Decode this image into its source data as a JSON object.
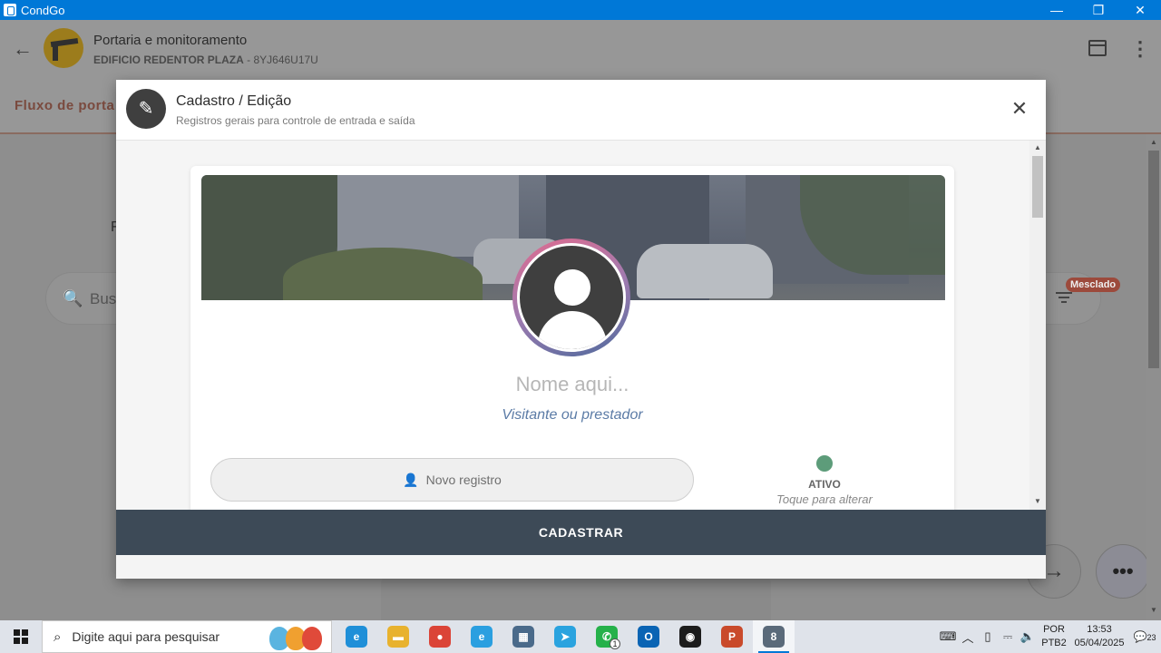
{
  "window": {
    "title": "CondGo",
    "minimize": "—",
    "restore": "❐",
    "close": "✕"
  },
  "app_header": {
    "back": "←",
    "title": "Portaria e monitoramento",
    "building": "EDIFICIO REDENTOR PLAZA",
    "code": " - 8YJ646U17U",
    "menu": "⋮"
  },
  "background": {
    "tab_label": "Fluxo de porta",
    "letter": "F",
    "search_icon": "🔍",
    "search_placeholder": "Bus",
    "badge": "Mesclado",
    "fab_next": "→",
    "fab_more": "•••"
  },
  "modal": {
    "edit_icon": "✎",
    "title": "Cadastro / Edição",
    "subtitle": "Registros gerais para controle de entrada e saída",
    "close": "✕",
    "name_placeholder": "Nome aqui...",
    "role": "Visitante ou prestador",
    "new_register_icon": "👤",
    "new_register_label": "Novo registro",
    "status_label": "ATIVO",
    "status_hint": "Toque para alterar",
    "status_color": "#5d9c7a",
    "submit_label": "CADASTRAR"
  },
  "taskbar": {
    "search_placeholder": "Digite aqui para pesquisar",
    "apps": [
      {
        "name": "edge",
        "glyph": "e",
        "color": "#1f8fd8"
      },
      {
        "name": "explorer",
        "glyph": "▬",
        "color": "#e8b22e"
      },
      {
        "name": "chrome",
        "glyph": "●",
        "color": "#db4437"
      },
      {
        "name": "ie",
        "glyph": "e",
        "color": "#2a9fe0"
      },
      {
        "name": "calculator",
        "glyph": "▦",
        "color": "#4a6a8a"
      },
      {
        "name": "telegram",
        "glyph": "➤",
        "color": "#2aa3df"
      },
      {
        "name": "whatsapp",
        "glyph": "✆",
        "color": "#25b14a"
      },
      {
        "name": "outlook",
        "glyph": "O",
        "color": "#0a64b4"
      },
      {
        "name": "chat-app",
        "glyph": "◉",
        "color": "#1c1c1c"
      },
      {
        "name": "powerpoint",
        "glyph": "P",
        "color": "#c94a2b"
      },
      {
        "name": "condgo",
        "glyph": "8",
        "color": "#5a6a7a"
      }
    ],
    "whatsapp_badge": "1",
    "lang_top": "POR",
    "lang_bottom": "PTB2",
    "time": "13:53",
    "date": "05/04/2025",
    "notifications": "23"
  }
}
